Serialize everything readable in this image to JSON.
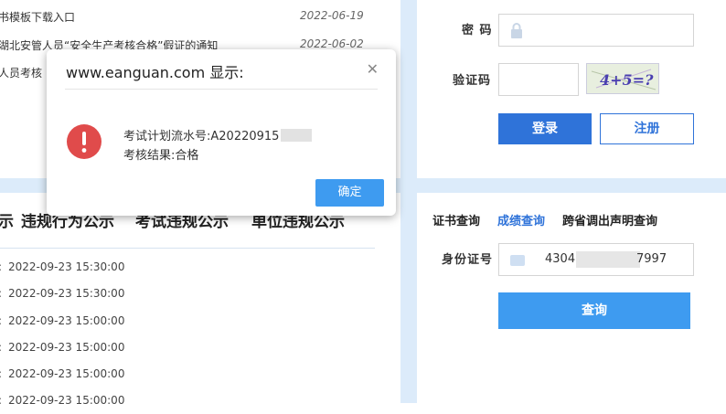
{
  "news": [
    {
      "title": "书模板下载入口",
      "date": "2022-06-19"
    },
    {
      "title": "湖北安管人员“安全生产考核合格”假证的通知",
      "date": "2022-06-02"
    },
    {
      "title": "人员考核",
      "date": ""
    }
  ],
  "notice_tabs": [
    "示",
    "违规行为公示",
    "考试违规公示",
    "单位违规公示"
  ],
  "notice_list": [
    {
      "bullet": ":",
      "time": "2022-09-23 15:30:00"
    },
    {
      "bullet": ":",
      "time": "2022-09-23 15:30:00"
    },
    {
      "bullet": ":",
      "time": "2022-09-23 15:00:00"
    },
    {
      "bullet": ":",
      "time": "2022-09-23 15:00:00"
    },
    {
      "bullet": ":",
      "time": "2022-09-23 15:00:00"
    },
    {
      "bullet": ":",
      "time": "2022-09-23 15:00:00"
    }
  ],
  "login": {
    "password_label": "密 码",
    "captcha_label": "验证码",
    "captcha_text": "4+5=?",
    "login_button": "登录",
    "register_button": "注册"
  },
  "query": {
    "tabs": [
      "证书查询",
      "成绩查询",
      "跨省调出声明查询"
    ],
    "active_tab": "成绩查询",
    "id_label": "身份证号",
    "id_prefix": "4304",
    "id_suffix": "7997",
    "query_button": "查询"
  },
  "dialog": {
    "title": "www.eanguan.com 显示:",
    "line1": "考试计划流水号:A20220915",
    "line2": "考核结果:合格",
    "ok_button": "确定",
    "error_color": "#e04b4b"
  },
  "colors": {
    "accent": "#2f73d9",
    "accent_light": "#3e9bf0",
    "band": "#dcebfa"
  }
}
